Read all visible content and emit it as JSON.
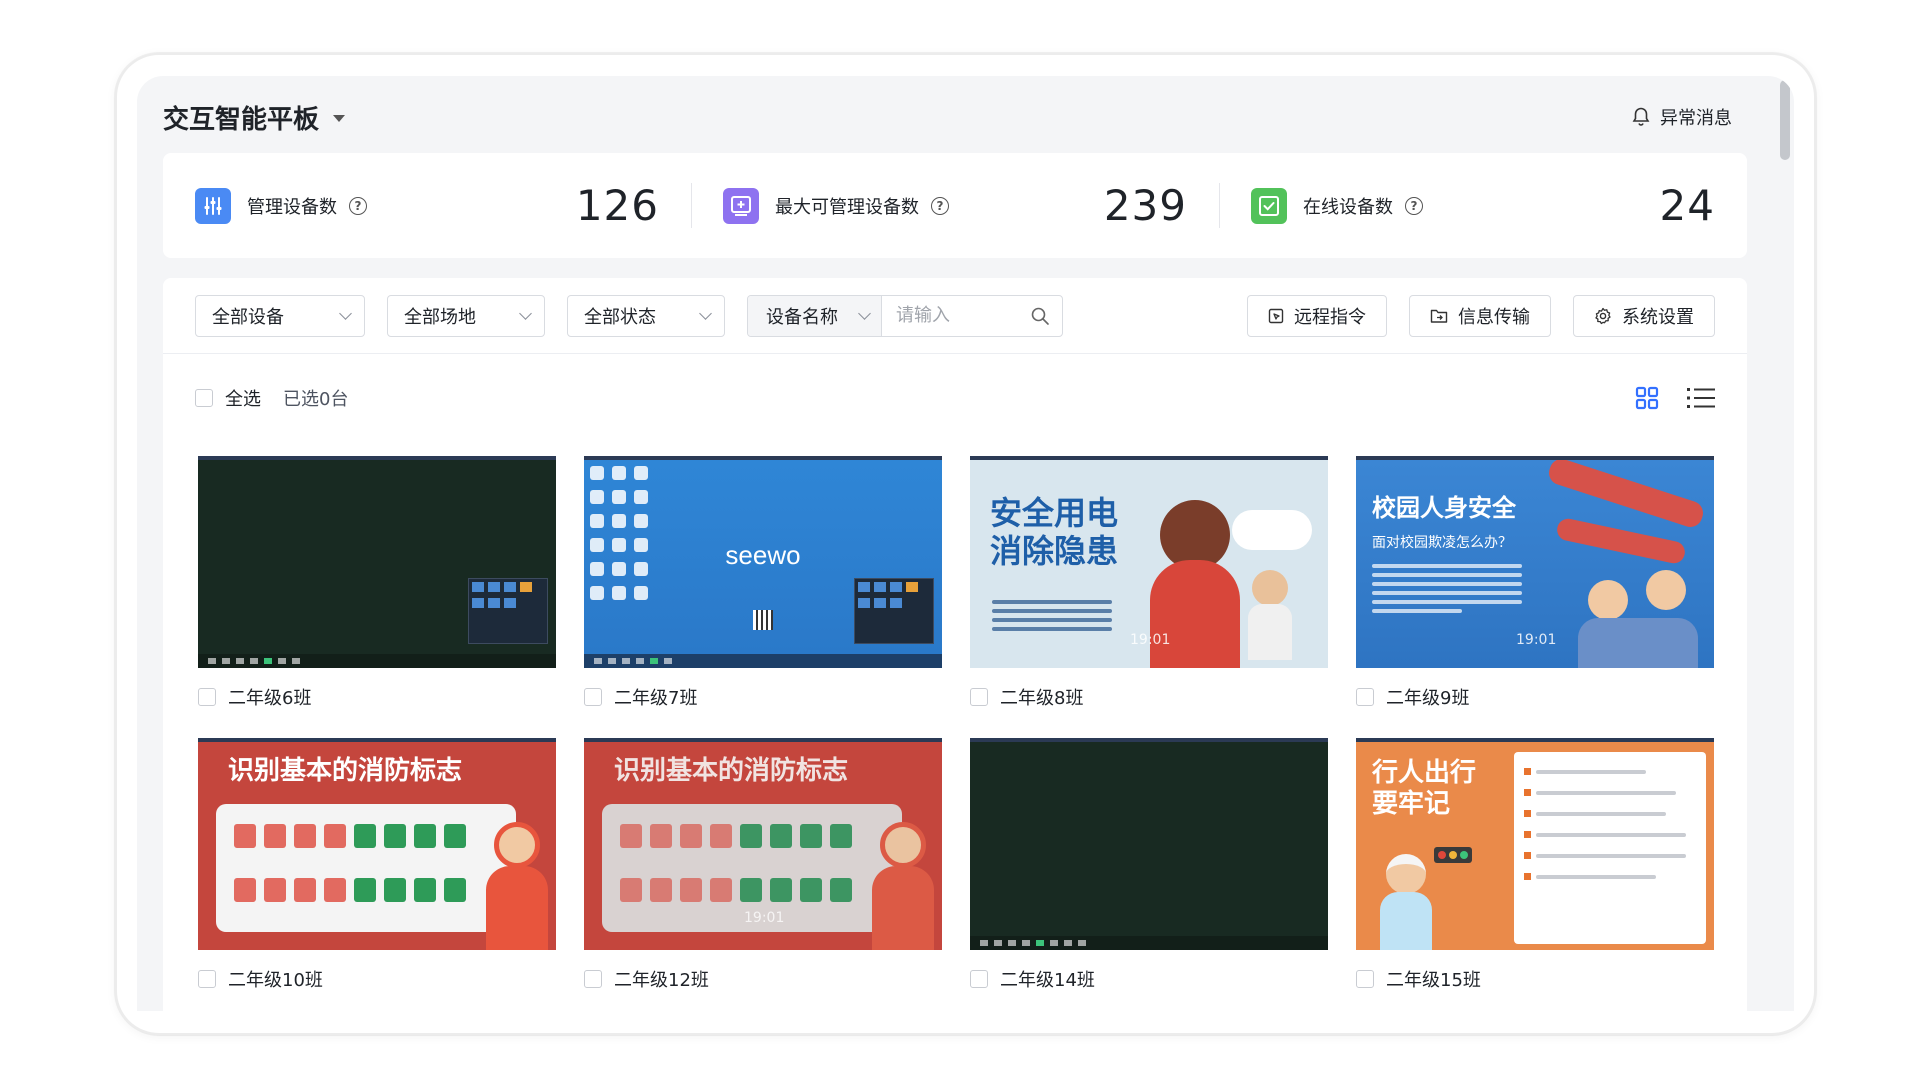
{
  "header": {
    "title": "交互智能平板",
    "alert_label": "异常消息"
  },
  "stats": [
    {
      "label": "管理设备数",
      "value": "126",
      "icon": "sliders-icon",
      "color": "#4a8af4"
    },
    {
      "label": "最大可管理设备数",
      "value": "239",
      "icon": "add-box-icon",
      "color": "#8e72f0"
    },
    {
      "label": "在线设备数",
      "value": "24",
      "icon": "checkbox-icon",
      "color": "#52c25a"
    }
  ],
  "toolbar": {
    "filters": [
      {
        "label": "全部设备"
      },
      {
        "label": "全部场地"
      },
      {
        "label": "全部状态"
      }
    ],
    "search": {
      "type_label": "设备名称",
      "placeholder": "请输入"
    },
    "buttons": [
      {
        "label": "远程指令",
        "icon": "remote-command-icon"
      },
      {
        "label": "信息传输",
        "icon": "send-file-icon"
      },
      {
        "label": "系统设置",
        "icon": "gear-icon"
      }
    ]
  },
  "selection": {
    "select_all_label": "全选",
    "selected_count": "已选0台"
  },
  "view_toggle": {
    "active": "grid",
    "grid_icon": "grid-view-icon",
    "list_icon": "list-view-icon",
    "active_color": "#3370ff"
  },
  "devices": [
    {
      "name": "二年级6班",
      "thumb": "dark-desktop"
    },
    {
      "name": "二年级7班",
      "thumb": "seewo-desktop",
      "brand": "seewo"
    },
    {
      "name": "二年级8班",
      "thumb": "electric-safety-poster",
      "poster_title": "安全用电消除隐患",
      "time": "19:01"
    },
    {
      "name": "二年级9班",
      "thumb": "campus-safety-poster",
      "poster_title": "校园人身安全",
      "poster_subtitle": "面对校园欺凌怎么办？",
      "time": "19:01"
    },
    {
      "name": "二年级10班",
      "thumb": "fire-sign-poster",
      "poster_title": "识别基本的消防标志"
    },
    {
      "name": "二年级12班",
      "thumb": "fire-sign-poster",
      "poster_title": "识别基本的消防标志",
      "time": "19:01"
    },
    {
      "name": "二年级14班",
      "thumb": "dark-desktop"
    },
    {
      "name": "二年级15班",
      "thumb": "pedestrian-safety-poster",
      "poster_title": "行人出行要牢记"
    }
  ]
}
